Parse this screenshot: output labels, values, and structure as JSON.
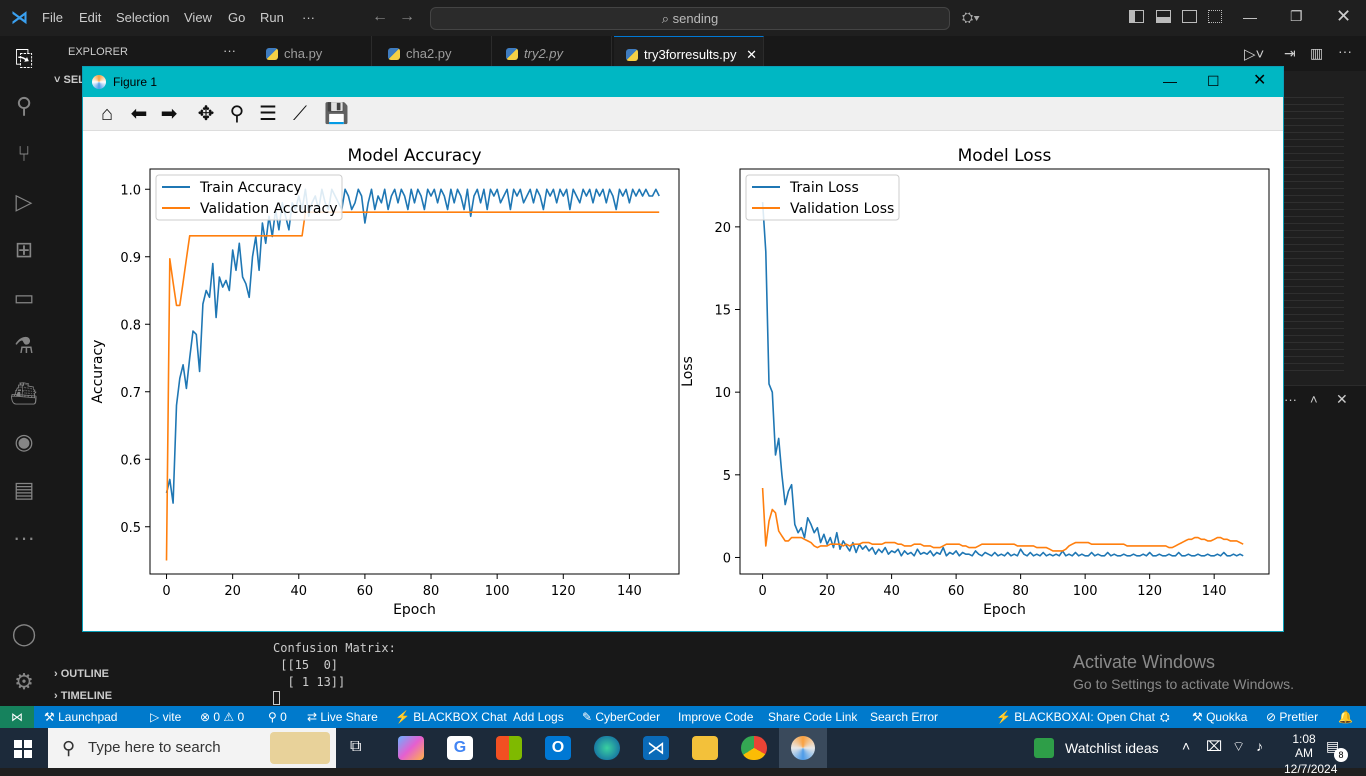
{
  "app": {
    "menu": [
      "File",
      "Edit",
      "Selection",
      "View",
      "Go",
      "Run",
      "···"
    ],
    "search_text": "sending"
  },
  "sidebar": {
    "title": "EXPLORER",
    "section_partial": "SEL",
    "outline": "OUTLINE",
    "timeline": "TIMELINE"
  },
  "tabs": [
    {
      "label": "cha.py"
    },
    {
      "label": "cha2.py"
    },
    {
      "label": "try2.py"
    },
    {
      "label": "try3forresults.py"
    }
  ],
  "figure": {
    "window_title": "Figure 1"
  },
  "terminal": {
    "lines": [
      "Confusion Matrix:",
      " [[15  0]",
      "  [ 1 13]]"
    ]
  },
  "watermark": {
    "title": "Activate Windows",
    "subtitle": "Go to Settings to activate Windows."
  },
  "statusbar": {
    "items": [
      "Launchpad",
      "vite",
      "⊗ 0 ⚠ 0",
      "⚲ 0",
      "Live Share",
      "BLACKBOX Chat",
      "Add Logs",
      "CyberCoder",
      "Improve Code",
      "Share Code Link",
      "Search Error"
    ],
    "right_items": [
      "BLACKBOXAI: Open Chat",
      "Quokka",
      "Prettier"
    ]
  },
  "taskbar": {
    "search_placeholder": "Type here to search",
    "widget": "Watchlist ideas",
    "time": "1:08 AM",
    "date": "12/7/2024",
    "notif_count": "8"
  },
  "colors": {
    "train": "#1f77b4",
    "val": "#ff7f0e",
    "accent": "#007acc",
    "figtitle": "#00b7c3"
  },
  "chart_data": [
    {
      "type": "line",
      "title": "Model Accuracy",
      "xlabel": "Epoch",
      "ylabel": "Accuracy",
      "xlim": [
        -5,
        155
      ],
      "ylim": [
        0.43,
        1.03
      ],
      "xticks": [
        0,
        20,
        40,
        60,
        80,
        100,
        120,
        140
      ],
      "yticks": [
        0.5,
        0.6,
        0.7,
        0.8,
        0.9,
        1.0
      ],
      "legend": "upper-left",
      "series": [
        {
          "name": "Train Accuracy",
          "values": [
            0.55,
            0.57,
            0.535,
            0.68,
            0.72,
            0.74,
            0.705,
            0.75,
            0.79,
            0.785,
            0.73,
            0.83,
            0.85,
            0.84,
            0.89,
            0.81,
            0.87,
            0.855,
            0.865,
            0.85,
            0.91,
            0.88,
            0.92,
            0.87,
            0.86,
            0.84,
            0.9,
            0.93,
            0.88,
            0.95,
            0.92,
            0.96,
            0.93,
            0.97,
            0.94,
            0.98,
            0.96,
            0.94,
            0.98,
            0.97,
            0.99,
            0.97,
            1.0,
            0.96,
            0.98,
            0.99,
            0.97,
            1.0,
            0.98,
            0.97,
            1.0,
            0.99,
            0.98,
            0.97,
            1.0,
            0.99,
            0.97,
            0.98,
            1.0,
            0.99,
            0.95,
            0.98,
            1.0,
            0.97,
            0.99,
            0.98,
            1.0,
            0.97,
            0.99,
            1.0,
            0.98,
            1.0,
            0.99,
            0.97,
            1.0,
            0.98,
            1.0,
            0.99,
            0.97,
            1.0,
            0.99,
            1.0,
            0.98,
            1.0,
            0.99,
            0.97,
            1.0,
            0.98,
            1.0,
            0.99,
            0.97,
            1.0,
            0.96,
            0.99,
            1.0,
            0.98,
            1.0,
            0.97,
            1.0,
            0.99,
            1.0,
            0.98,
            0.99,
            1.0,
            0.97,
            1.0,
            0.99,
            1.0,
            0.98,
            0.99,
            1.0,
            0.98,
            1.0,
            0.99,
            0.97,
            1.0,
            0.99,
            1.0,
            0.98,
            1.0,
            0.99,
            1.0,
            0.97,
            1.0,
            0.99,
            0.98,
            1.0,
            0.99,
            1.0,
            0.98,
            1.0,
            0.99,
            1.0,
            0.98,
            1.0,
            0.99,
            0.97,
            1.0,
            0.99,
            1.0,
            0.98,
            1.0,
            0.99,
            1.0,
            0.99,
            1.0,
            0.99,
            0.99,
            1.0,
            0.99
          ]
        },
        {
          "name": "Validation Accuracy",
          "values": [
            0.45,
            0.897,
            0.862,
            0.828,
            0.828,
            0.862,
            0.897,
            0.931,
            0.931,
            0.931,
            0.931,
            0.931,
            0.931,
            0.931,
            0.931,
            0.931,
            0.931,
            0.931,
            0.931,
            0.931,
            0.931,
            0.931,
            0.931,
            0.931,
            0.931,
            0.931,
            0.931,
            0.931,
            0.931,
            0.931,
            0.931,
            0.931,
            0.931,
            0.931,
            0.931,
            0.931,
            0.931,
            0.931,
            0.931,
            0.931,
            0.931,
            0.931,
            0.966,
            0.966,
            0.966,
            0.966,
            0.966,
            0.966,
            0.966,
            0.966,
            0.966,
            0.966,
            0.966,
            0.966,
            0.966,
            0.966,
            0.966,
            0.966,
            0.966,
            0.966,
            0.966,
            0.966,
            0.966,
            0.966,
            0.966,
            0.966,
            0.966,
            0.966,
            0.966,
            0.966,
            0.966,
            0.966,
            0.966,
            0.966,
            0.966,
            0.966,
            0.966,
            0.966,
            0.966,
            0.966,
            0.966,
            0.966,
            0.966,
            0.966,
            0.966,
            0.966,
            0.966,
            0.966,
            0.966,
            0.966,
            0.966,
            0.966,
            0.966,
            0.966,
            0.966,
            0.966,
            0.966,
            0.966,
            0.966,
            0.966,
            0.966,
            0.966,
            0.966,
            0.966,
            0.966,
            0.966,
            0.966,
            0.966,
            0.966,
            0.966,
            0.966,
            0.966,
            0.966,
            0.966,
            0.966,
            0.966,
            0.966,
            0.966,
            0.966,
            0.966,
            0.966,
            0.966,
            0.966,
            0.966,
            0.966,
            0.966,
            0.966,
            0.966,
            0.966,
            0.966,
            0.966,
            0.966,
            0.966,
            0.966,
            0.966,
            0.966,
            0.966,
            0.966,
            0.966,
            0.966,
            0.966,
            0.966,
            0.966,
            0.966,
            0.966,
            0.966,
            0.966,
            0.966,
            0.966,
            0.966
          ]
        }
      ]
    },
    {
      "type": "line",
      "title": "Model Loss",
      "xlabel": "Epoch",
      "ylabel": "Loss",
      "xlim": [
        -7,
        157
      ],
      "ylim": [
        -1.0,
        23.5
      ],
      "xticks": [
        0,
        20,
        40,
        60,
        80,
        100,
        120,
        140
      ],
      "yticks": [
        0,
        5,
        10,
        15,
        20
      ],
      "legend": "upper-left",
      "series": [
        {
          "name": "Train Loss",
          "values": [
            21.5,
            18.5,
            10.5,
            10.0,
            6.2,
            7.2,
            5.0,
            3.2,
            4.0,
            4.4,
            2.0,
            1.5,
            1.8,
            1.2,
            2.4,
            2.0,
            1.5,
            1.8,
            0.9,
            1.4,
            0.8,
            1.2,
            0.6,
            1.5,
            0.5,
            1.0,
            0.7,
            0.4,
            0.9,
            0.3,
            0.8,
            0.5,
            0.7,
            0.4,
            0.6,
            0.2,
            0.5,
            0.3,
            0.6,
            0.2,
            0.4,
            0.3,
            0.5,
            0.1,
            0.4,
            0.2,
            0.3,
            0.1,
            0.5,
            0.2,
            0.3,
            0.2,
            0.4,
            0.1,
            0.3,
            0.2,
            0.6,
            0.1,
            0.3,
            0.2,
            0.4,
            0.1,
            0.3,
            0.2,
            0.2,
            0.1,
            0.4,
            0.2,
            0.1,
            0.3,
            0.2,
            0.1,
            0.3,
            0.1,
            0.2,
            0.1,
            0.3,
            0.1,
            0.2,
            0.1,
            0.5,
            0.2,
            0.1,
            0.3,
            0.1,
            0.2,
            0.1,
            0.3,
            0.1,
            0.2,
            0.1,
            0.2,
            0.1,
            0.4,
            0.1,
            0.2,
            0.1,
            0.3,
            0.1,
            0.2,
            0.1,
            0.1,
            0.3,
            0.1,
            0.2,
            0.1,
            0.1,
            0.3,
            0.1,
            0.2,
            0.1,
            0.1,
            0.2,
            0.1,
            0.1,
            0.2,
            0.1,
            0.1,
            0.2,
            0.1,
            0.3,
            0.1,
            0.1,
            0.2,
            0.1,
            0.1,
            0.2,
            0.1,
            0.1,
            0.3,
            0.1,
            0.1,
            0.2,
            0.1,
            0.1,
            0.2,
            0.1,
            0.1,
            0.2,
            0.1,
            0.1,
            0.2,
            0.1,
            0.3,
            0.1,
            0.1,
            0.2,
            0.1,
            0.2,
            0.1
          ]
        },
        {
          "name": "Validation Loss",
          "values": [
            4.2,
            0.7,
            2.2,
            2.9,
            2.7,
            1.6,
            1.3,
            1.0,
            1.0,
            1.2,
            1.2,
            1.2,
            1.2,
            1.1,
            1.0,
            0.9,
            0.7,
            0.6,
            0.7,
            0.7,
            0.7,
            0.8,
            0.8,
            0.8,
            0.8,
            0.7,
            0.8,
            0.7,
            0.8,
            0.8,
            0.8,
            0.9,
            0.9,
            0.9,
            0.8,
            0.8,
            0.8,
            0.8,
            0.9,
            0.9,
            0.9,
            0.9,
            0.8,
            0.8,
            0.7,
            0.7,
            0.7,
            0.8,
            0.8,
            0.8,
            0.7,
            0.7,
            0.7,
            0.6,
            0.6,
            0.6,
            0.7,
            0.8,
            0.8,
            0.8,
            0.8,
            0.8,
            0.7,
            0.7,
            0.6,
            0.6,
            0.6,
            0.7,
            0.8,
            0.8,
            0.8,
            0.8,
            0.8,
            0.8,
            0.8,
            0.8,
            0.8,
            0.8,
            0.8,
            0.7,
            0.7,
            0.7,
            0.7,
            0.7,
            0.7,
            0.6,
            0.6,
            0.6,
            0.6,
            0.5,
            0.4,
            0.4,
            0.4,
            0.4,
            0.5,
            0.7,
            0.8,
            0.9,
            0.9,
            0.9,
            0.9,
            0.9,
            0.8,
            0.8,
            0.8,
            0.8,
            0.8,
            0.8,
            0.8,
            0.8,
            0.8,
            0.8,
            0.8,
            0.7,
            0.7,
            0.7,
            0.7,
            0.7,
            0.7,
            0.7,
            0.7,
            0.7,
            0.7,
            0.7,
            0.7,
            0.7,
            0.6,
            0.6,
            0.7,
            0.8,
            0.9,
            1.0,
            1.1,
            1.1,
            1.2,
            1.2,
            1.1,
            1.1,
            1.0,
            1.0,
            1.1,
            1.2,
            1.2,
            1.1,
            1.1,
            1.0,
            1.0,
            1.0,
            0.9,
            0.8
          ]
        }
      ]
    }
  ]
}
